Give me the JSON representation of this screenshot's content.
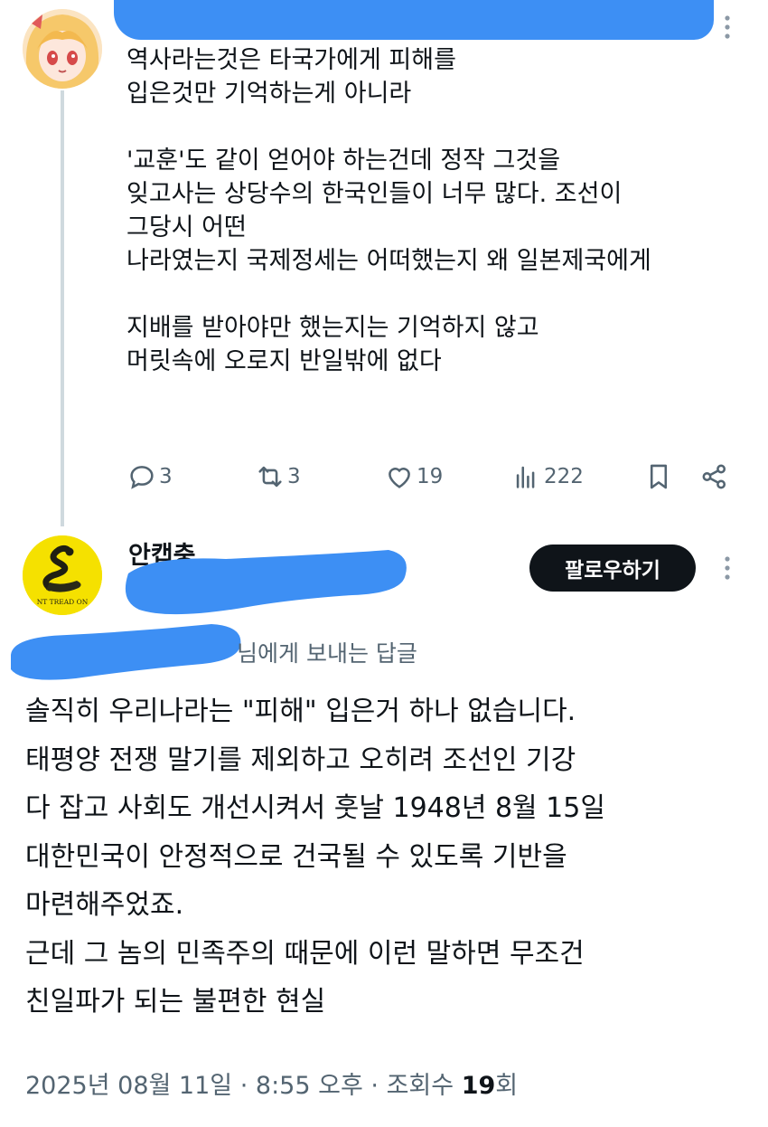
{
  "first_tweet": {
    "avatar_icon": "anime-girl-avatar-icon",
    "text": "역사라는것은 타국가에게 피해를\n입은것만 기억하는게 아니라\n\n'교훈'도 같이 얻어야 하는건데 정작 그것을\n잊고사는 상당수의 한국인들이 너무 많다. 조선이\n그당시 어떤\n나라였는지 국제정세는 어떠했는지 왜 일본제국에게\n\n지배를 받아야만 했는지는 기억하지 않고\n머릿속에 오로지 반일밖에 없다",
    "actions": {
      "replies": "3",
      "retweets": "3",
      "likes": "19",
      "views": "222"
    }
  },
  "reply_tweet": {
    "avatar_icon": "gadsden-flag-avatar-icon",
    "author_name": "안캡충",
    "follow_label": "팔로우하기",
    "reply_to_suffix": "님에게 보내는 답글",
    "text": "솔직히 우리나라는 \"피해\" 입은거 하나 없습니다.\n태평양 전쟁 말기를 제외하고 오히려 조선인 기강\n다 잡고 사회도 개선시켜서 훗날 1948년 8월 15일\n대한민국이 안정적으로 건국될 수 있도록 기반을\n마련해주었죠.\n근데 그 놈의 민족주의 때문에 이런 말하면 무조건\n친일파가 되는 불편한 현실",
    "meta": {
      "date": "2025년 08월 11일",
      "time": "8:55 오후",
      "views_label": "조회수",
      "views_count": "19",
      "views_suffix": "회"
    }
  },
  "colors": {
    "redaction_blue": "#3d8ff4",
    "text_primary": "#0f1419",
    "text_secondary": "#536471",
    "thread_line": "#cfd9de"
  }
}
